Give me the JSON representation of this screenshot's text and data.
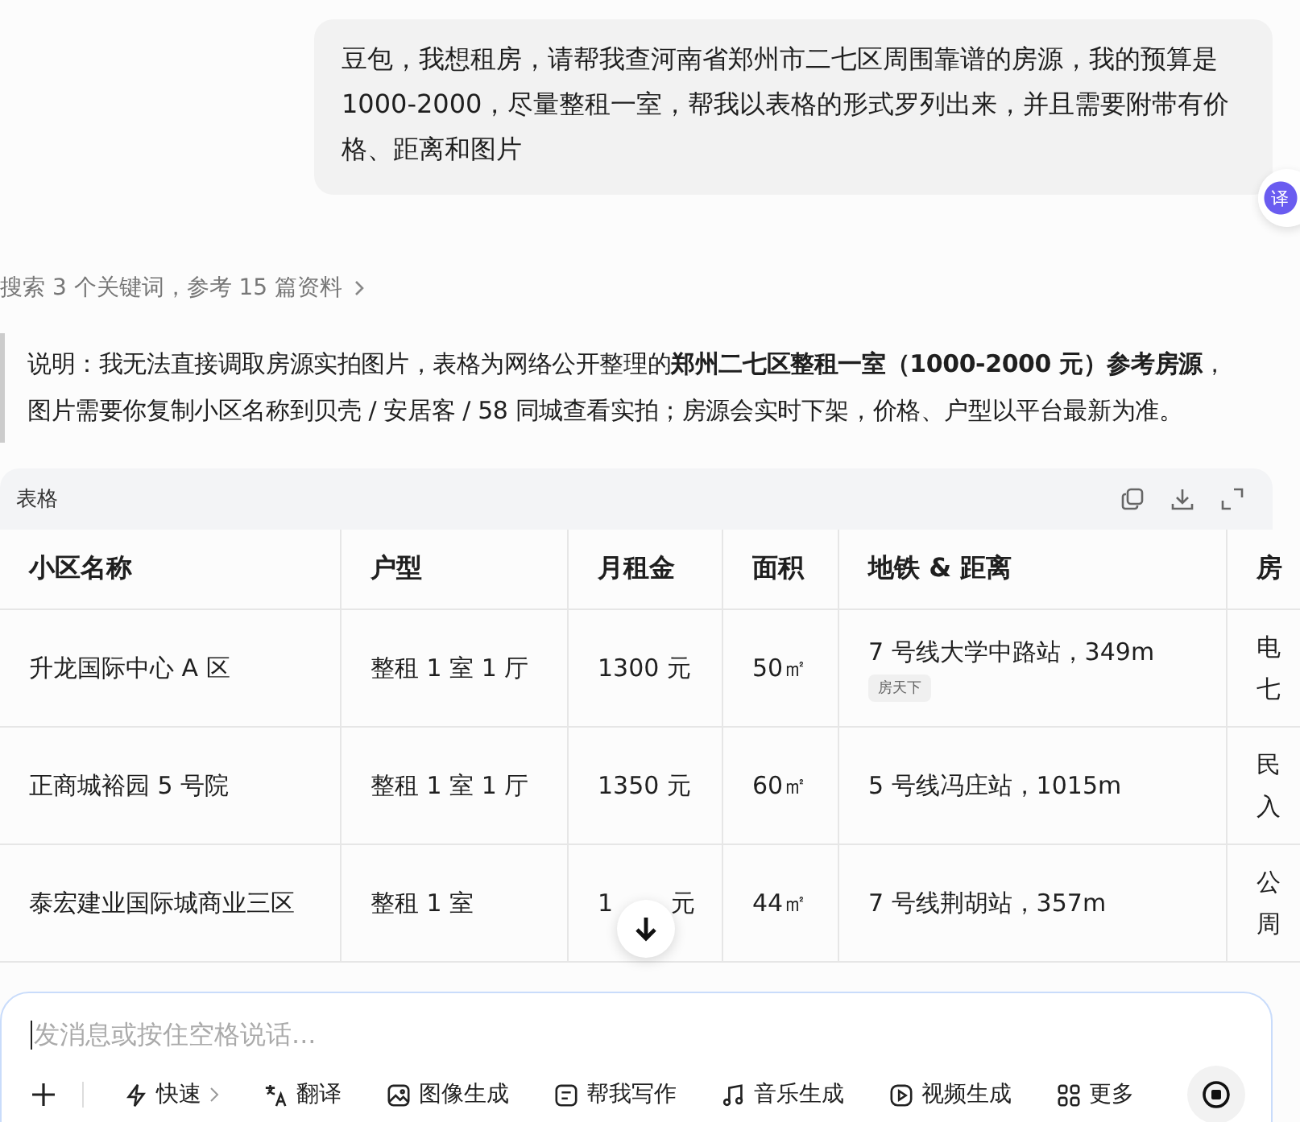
{
  "user_message": "豆包，我想租房，请帮我查河南省郑州市二七区周围靠谱的房源，我的预算是1000-2000，尽量整租一室，帮我以表格的形式罗列出来，并且需要附带有价格、距离和图片",
  "translate_button": {
    "label": "译"
  },
  "search_summary": "搜索 3 个关键词，参考 15 篇资料",
  "note": "说明：我无法直接调取房源实拍图片，表格为网络公开整理的**郑州二七区整租一室（1000-2000 元）参考房源**，图片需要你复制小区名称到贝壳 / 安居客 / 58 同城查看实拍；房源会实时下架，价格、户型以平台最新为准。",
  "table": {
    "title": "表格",
    "columns": [
      "小区名称",
      "户型",
      "月租金",
      "面积",
      "地铁 & 距离",
      "房"
    ],
    "rows": [
      {
        "name": "升龙国际中心 A 区",
        "layout": "整租 1 室 1 厅",
        "rent": "1300 元",
        "area": "50㎡",
        "subway": "7 号线大学中路站，349m",
        "source_tag": "房天下",
        "column_6": [
          "电",
          "七"
        ]
      },
      {
        "name": "正商城裕园 5 号院",
        "layout": "整租 1 室 1 厅",
        "rent": "1350 元",
        "area": "60㎡",
        "subway": "5 号线冯庄站，1015m",
        "column_6": [
          "民",
          "入"
        ]
      },
      {
        "name": "泰宏建业国际城商业三区",
        "layout": "整租 1 室",
        "rent": "1",
        "rent_tail": "元",
        "area": "44㎡",
        "subway": "7 号线荆胡站，357m",
        "column_6": [
          "公",
          "周"
        ]
      }
    ]
  },
  "composer": {
    "placeholder": "发消息或按住空格说话...",
    "tools": [
      {
        "kind": "bolt",
        "label": "快速",
        "chevron": true
      },
      {
        "kind": "translate",
        "label": "翻译"
      },
      {
        "kind": "image",
        "label": "图像生成"
      },
      {
        "kind": "write",
        "label": "帮我写作"
      },
      {
        "kind": "music",
        "label": "音乐生成"
      },
      {
        "kind": "video",
        "label": "视频生成"
      },
      {
        "kind": "grid",
        "label": "更多"
      }
    ]
  }
}
